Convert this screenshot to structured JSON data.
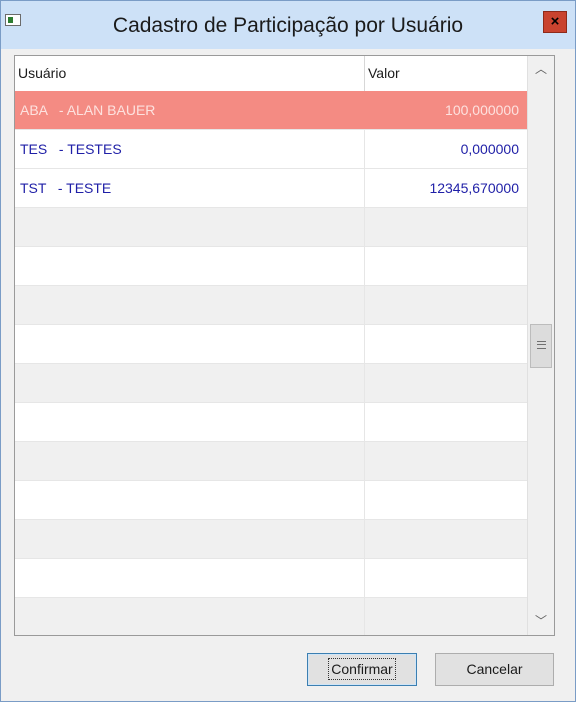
{
  "window": {
    "title": "Cadastro de Participação por Usuário",
    "close_label": "×"
  },
  "grid": {
    "columns": [
      "Usuário",
      "Valor"
    ],
    "rows": [
      {
        "user": "ABA   - ALAN BAUER",
        "value": "100,000000",
        "selected": true
      },
      {
        "user": "TES   - TESTES",
        "value": "0,000000"
      },
      {
        "user": "TST   - TESTE",
        "value": "12345,670000"
      }
    ],
    "scrollbar": {
      "up_icon": "chevron-up-icon",
      "down_icon": "chevron-down-icon",
      "thumb_icon": "grip-icon"
    }
  },
  "buttons": {
    "confirm": "Confirmar",
    "cancel": "Cancelar"
  },
  "colors": {
    "selected_row_bg": "#f48b83",
    "selected_row_text": "#fde2df",
    "row_text": "#1f1fa7",
    "alt_row_bg": "#f0f0f0"
  }
}
